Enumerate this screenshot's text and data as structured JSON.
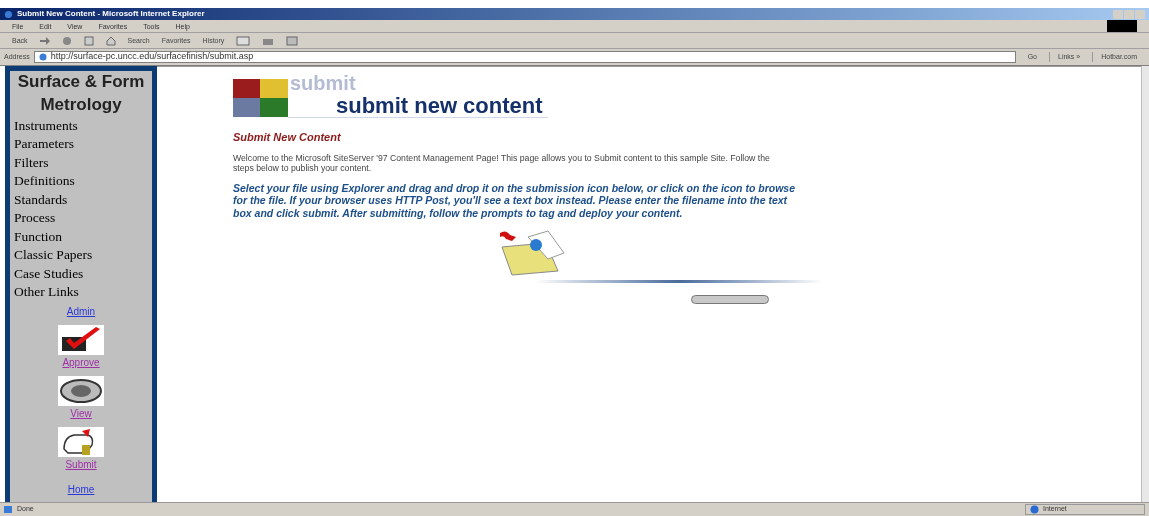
{
  "window": {
    "title": "Submit New Content - Microsoft Internet Explorer"
  },
  "menu": [
    "File",
    "Edit",
    "View",
    "Favorites",
    "Tools",
    "Help"
  ],
  "toolbar": {
    "back": "Back",
    "search": "Search",
    "favorites": "Favorites",
    "history": "History"
  },
  "address_bar": {
    "label": "Address",
    "value": "http://surface-pc.uncc.edu/surfacefinish/submit.asp",
    "go": "Go",
    "links": "Links »",
    "hotbar": "Hotbar.com"
  },
  "sidebar": {
    "title": "Surface & Form Metrology",
    "items": [
      {
        "label": "Instruments"
      },
      {
        "label": "Parameters"
      },
      {
        "label": "Filters"
      },
      {
        "label": "Definitions"
      },
      {
        "label": "Standards"
      },
      {
        "label": "Process"
      },
      {
        "label": "Function"
      },
      {
        "label": "Classic Papers"
      },
      {
        "label": "Case Studies"
      },
      {
        "label": "Other Links"
      }
    ],
    "admin": "Admin",
    "tools": [
      {
        "kind": "approve",
        "label": "Approve"
      },
      {
        "kind": "view",
        "label": "View"
      },
      {
        "kind": "submit",
        "label": "Submit"
      }
    ],
    "home": "Home"
  },
  "banner": {
    "ghost": "submit",
    "title": "submit new content"
  },
  "heading": "Submit New Content",
  "intro": "Welcome to the Microsoft SiteServer '97 Content Management Page! This page allows you to Submit content to this sample Site. Follow the steps below to publish your content.",
  "instructions": "Select your file using Explorer and drag and drop it on the submission icon below, or click on the icon to browse for the file. If your browser uses HTTP Post, you'll see a text box instead. Please enter the filename into the text box and click submit. After submitting, follow the prompts to tag and deploy your content.",
  "status_bar": {
    "text": "Done",
    "zone": "Internet"
  }
}
